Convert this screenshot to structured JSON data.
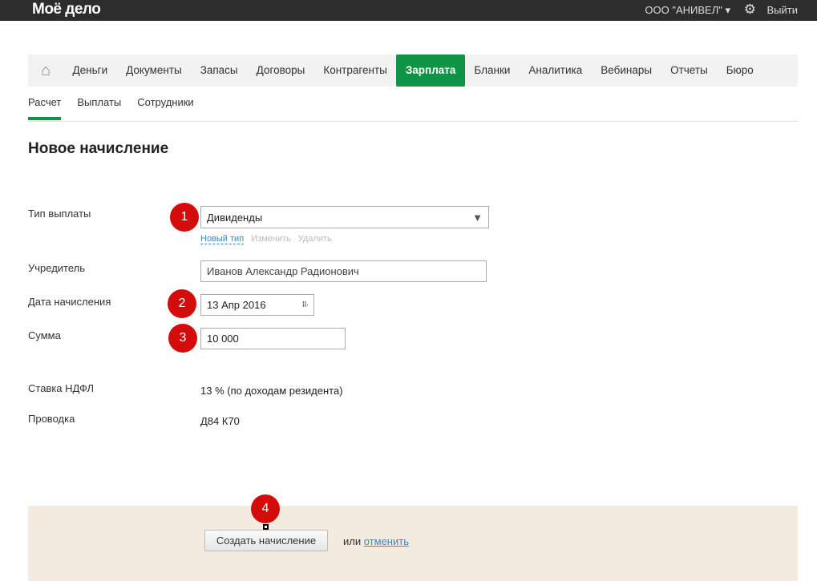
{
  "header": {
    "logo": "Моё дело",
    "org": "ООО \"АНИВЕЛ\" ▾",
    "exit": "Выйти"
  },
  "nav": {
    "items": [
      "Деньги",
      "Документы",
      "Запасы",
      "Договоры",
      "Контрагенты",
      "Зарплата",
      "Бланки",
      "Аналитика",
      "Вебинары",
      "Отчеты",
      "Бюро"
    ],
    "active": "Зарплата"
  },
  "subnav": {
    "items": [
      "Расчет",
      "Выплаты",
      "Сотрудники"
    ],
    "active": "Расчет"
  },
  "page_title": "Новое начисление",
  "form": {
    "payment_type": {
      "label": "Тип выплаты",
      "value": "Дивиденды",
      "links": [
        "Новый тип",
        "Изменить",
        "Удалить"
      ]
    },
    "founder": {
      "label": "Учредитель",
      "value": "Иванов Александр Радионович"
    },
    "date": {
      "label": "Дата начисления",
      "value": "13 Апр 2016"
    },
    "amount": {
      "label": "Сумма",
      "value": "10 000"
    },
    "ndfl": {
      "label": "Ставка НДФЛ",
      "value": "13 % (по доходам резидента)"
    },
    "posting": {
      "label": "Проводка",
      "value": "Д84 К70"
    }
  },
  "footer": {
    "create": "Создать начисление",
    "or": "или",
    "cancel": "отменить"
  },
  "badges": [
    "1",
    "2",
    "3",
    "4"
  ],
  "colors": {
    "accent": "#0d9444",
    "badge": "#d40b0b",
    "link": "#3a87c8"
  }
}
